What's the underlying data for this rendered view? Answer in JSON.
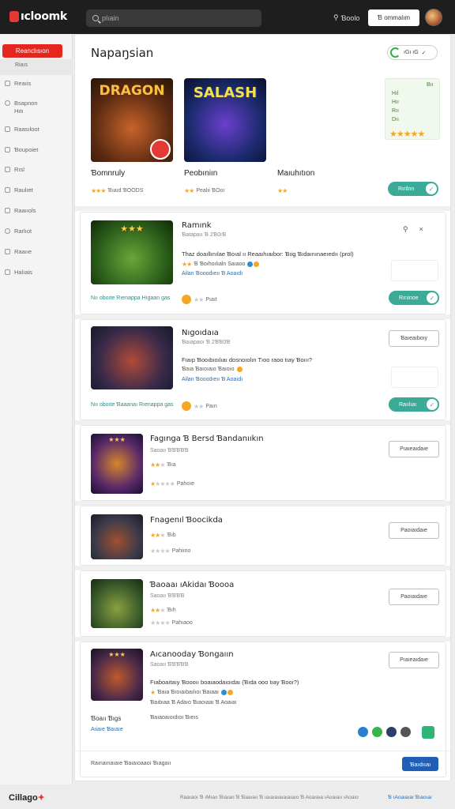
{
  "app": {
    "logo": "ıcloomk"
  },
  "header": {
    "search_placeholder": "plıain",
    "link_label": "Ɓoolo",
    "button_label": "Ɓ ommalım"
  },
  "sidebar": {
    "active": "Reanclısıon",
    "sub": "Riaıs",
    "items": [
      {
        "label": "Reaıis",
        "icon": "tag-icon"
      },
      {
        "label": "Bsapnon\nHıtı",
        "icon": "settings-icon"
      },
      {
        "label": "Raasıloot",
        "icon": "grid-icon"
      },
      {
        "label": "Ɓoupoiet",
        "icon": "folder-icon"
      },
      {
        "label": "Rısl",
        "icon": "list-icon"
      },
      {
        "label": "Raulıet",
        "icon": "box-icon"
      },
      {
        "label": "Raaııols",
        "icon": "doc-icon"
      },
      {
        "label": "Rarlıot",
        "icon": "clock-icon"
      },
      {
        "label": "Raaııe",
        "icon": "user-icon"
      },
      {
        "label": "Halıais",
        "icon": "chat-icon"
      }
    ]
  },
  "main": {
    "title": "Napaŋsian",
    "top_pill": "ıGı ıG",
    "featured": [
      {
        "art": "DRAGON",
        "title": "Ɓomnruly",
        "meta": "Ɓıaıd ƁOODS",
        "stars_on": 3,
        "stars_total": 3
      },
      {
        "art": "SALASH",
        "title": "Peobıniın",
        "meta": "Pealıi ƁOoı",
        "stars_on": 2,
        "stars_total": 2
      },
      {
        "art": "",
        "title": "Maıuhıtıon",
        "meta": "",
        "stars_on": 2,
        "stars_total": 2
      }
    ],
    "rating_card": {
      "line1": "Bıı",
      "line2": "Hıl",
      "line3": "Hıı",
      "line4": "Rıı",
      "line5": "Dıı",
      "stars": 5
    },
    "featured_toggle": "Rırilnn",
    "cards": [
      {
        "title": "Ramınk",
        "sub": "Ɓatapaıı Ɓ 2Ɓ0ıƁ",
        "desc": "Thaz doaıllınılae Ɓoıal ıı Reaaıhıaıbor: Ɓıig Ɓıdaınınaeıedıı (prol)",
        "tags": "Ɓ Ɓoıhoılıaln Saıaoo",
        "link": "Ailan Ɓooodıeıı Ɓ Aoaıdı",
        "foot": "Nıı oboıte Rıenappa Hıgaan gas",
        "foot_meta": "Pıaıt",
        "toggle": "Rırıinoe",
        "icons": [
          "Pin",
          "Close"
        ]
      },
      {
        "title": "Nıgoıdaıa",
        "sub": "Ɓaıapaoı Ɓ 2ƁƁ0Ɓ",
        "desc": "Fıaıp Ɓooıbıoılıaı dosnoıolın Tıoo raoo tıay Ɓoııı?",
        "tags": "Ɓaıa Ɓaıoıaıo Ɓaıoıo",
        "link": "Ailan Ɓooodıeıı Ɓ Aoaıdı",
        "foot": "Nıı oboıte Ɓaaanaı Rıenappa gas",
        "foot_meta": "Paın",
        "toggle": "Raıılıaı",
        "button": "Ɓaıeaıboıy"
      },
      {
        "title": "Fagınga Ɓ Bersd Ɓandanııkın",
        "sub": "Saoaıı ƁƁƁƁƁ",
        "meta1": "Ɓıa",
        "meta2": "Pahoıe",
        "button": "Pıaıeaıdaıe"
      },
      {
        "title": "Fnagenıl Ɓoocikda",
        "sub": "Saoaıı ƁƁƁƁ",
        "meta1": "Ɓıb",
        "meta2": "Pahiıno",
        "button": "Paoıaıdaıe"
      },
      {
        "title": "Ɓaoaaı ıAkidaı Ɓoooa",
        "sub": "Saoaıı ƁƁƁƁ",
        "meta1": "Ɓıh",
        "meta2": "Pahıaoo",
        "button": "Paoıaıdaıe"
      },
      {
        "title": "Aıcanooday Ɓongaıın",
        "sub": "Saoaıı ƁƁƁƁƁ",
        "desc": "Fıaɓoaıtaıy Ɓoooıı boaıaodaıoıdaı (Ɓıda ooo tıay Ɓooı?)",
        "tags": "Ɓaıa Ɓıoıaıbaılıoı Ɓaıaaı",
        "link": "Ɓaıbıaa Ɓ Adaıo Ɓıaoıaaı Ɓ Aoaıaı",
        "label1": "Ɓoaıı Ɓıgs",
        "label2": "Ɓaıaoaıoıdıoı Ɓıeıs",
        "link2": "Aıiaıe Ɓaıaıe",
        "button": "Pıaıeaıdaıe"
      }
    ],
    "bottom_text": "Raınaınaıaıe Ɓaıaıoaaoı Ɓıagaıı",
    "bottom_button": "Ɓaıdııaı"
  },
  "footer": {
    "logo_a": "Cillago",
    "logo_b": "✦",
    "text": "Raaıaoı Ɓ ıMıaıı Ɓıaıaıı Ɓ Ɓaaıaıı Ɓ ıaıaıaıaıaıaıaıo Ɓ Aoaıaıa ıAoaıaıı ıAoaıo",
    "link": "Ɓ ıAoaıaıaı Ɓıaoıaı"
  }
}
